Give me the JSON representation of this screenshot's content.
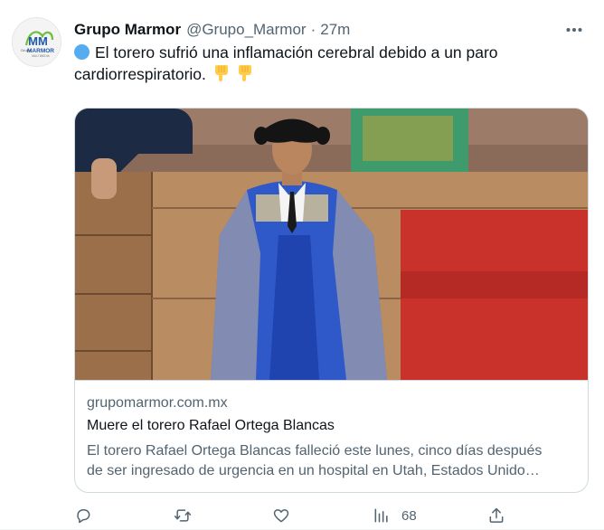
{
  "tweet": {
    "display_name": "Grupo Marmor",
    "handle": "@Grupo_Marmor",
    "separator": "·",
    "time": "27m",
    "text_line1": "El torero sufrió una inflamación cerebral debido a un paro",
    "text_line2": "cardiorrespiratorio.",
    "icons": [
      "blue-circle-emoji",
      "pointing-down-emoji",
      "pointing-down-emoji"
    ]
  },
  "avatar": {
    "logo_letters": "MM",
    "logo_word": "MARMOR",
    "logo_side": "Grupo",
    "logo_sub": "MULTIMEDIA"
  },
  "card": {
    "domain": "grupomarmor.com.mx",
    "title": "Muere el torero Rafael Ortega Blancas",
    "description_line1": "El torero Rafael Ortega Blancas falleció este lunes, cinco días después",
    "description_line2": "de ser ingresado de urgencia en un hospital en Utah, Estados Unido…"
  },
  "actions": {
    "views": "68",
    "icons": [
      "reply-icon",
      "retweet-icon",
      "like-icon",
      "views-icon",
      "share-icon"
    ]
  },
  "colors": {
    "text_primary": "#0f1419",
    "text_secondary": "#536471",
    "border": "#cfd9de",
    "emoji_blue": "#55acee",
    "emoji_yellow": "#ffcc4d"
  }
}
